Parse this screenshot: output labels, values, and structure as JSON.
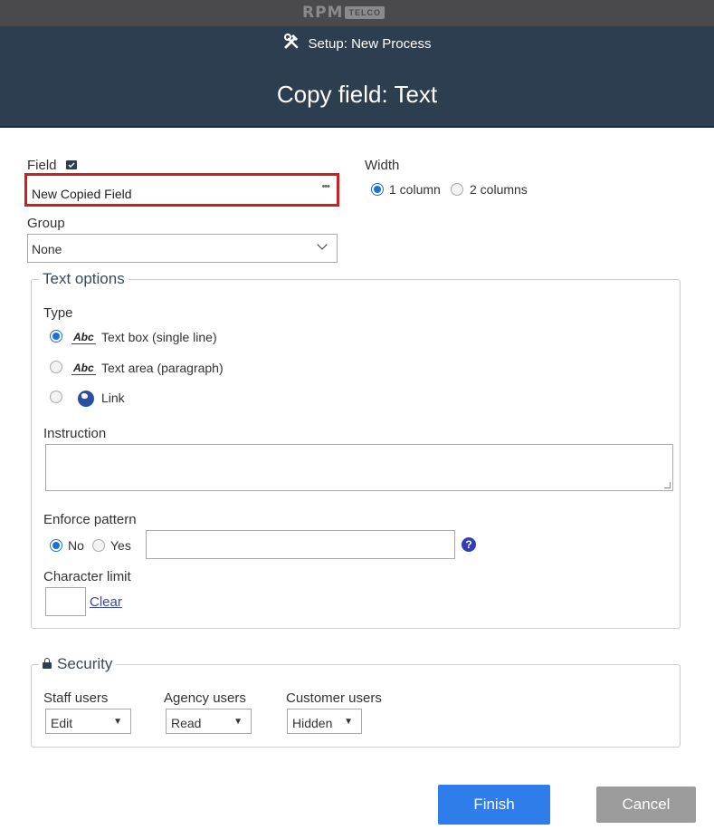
{
  "brand": {
    "logo_main": "RPM",
    "logo_box": "TELCO"
  },
  "header": {
    "subtitle": "Setup: New Process",
    "title": "Copy field: Text"
  },
  "field": {
    "label": "Field",
    "value": "New Copied Field",
    "dots": "•••"
  },
  "width": {
    "label": "Width",
    "options": [
      "1 column",
      "2 columns"
    ],
    "selected": "1 column"
  },
  "group": {
    "label": "Group",
    "value": "None"
  },
  "text_options": {
    "legend": "Text options",
    "type_label": "Type",
    "types": [
      {
        "label": "Text box (single line)",
        "icon": "abc-textbox-icon",
        "icon_text": "Abc",
        "selected": true
      },
      {
        "label": "Text area (paragraph)",
        "icon": "abc-textarea-icon",
        "icon_text": "Abc",
        "selected": false
      },
      {
        "label": "Link",
        "icon": "globe-link-icon",
        "selected": false
      }
    ],
    "instruction_label": "Instruction",
    "instruction_value": "",
    "enforce_label": "Enforce pattern",
    "enforce_options": [
      "No",
      "Yes"
    ],
    "enforce_selected": "No",
    "pattern_value": "",
    "help_glyph": "?",
    "char_limit_label": "Character limit",
    "char_limit_value": "",
    "clear_label": "Clear"
  },
  "security": {
    "legend": "Security",
    "staff": {
      "label": "Staff users",
      "value": "Edit"
    },
    "agency": {
      "label": "Agency users",
      "value": "Read"
    },
    "customer": {
      "label": "Customer users",
      "value": "Hidden"
    },
    "dropdown_glyph": "▼"
  },
  "buttons": {
    "finish": "Finish",
    "cancel": "Cancel"
  },
  "colors": {
    "header_bg": "#2d3e50",
    "finish": "#2f7dea",
    "cancel": "#9b9b9b",
    "highlight": "#cc1f1f"
  }
}
